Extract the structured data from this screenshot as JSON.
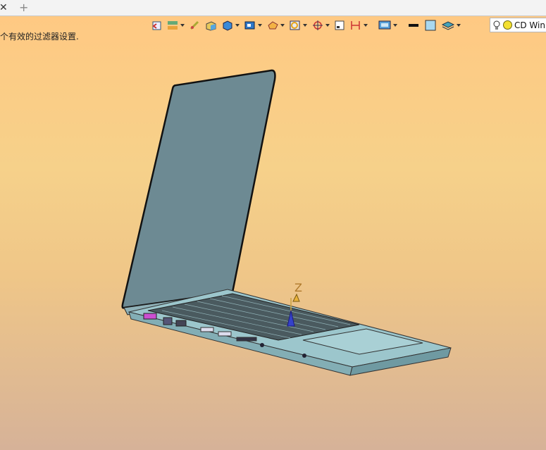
{
  "tabs": {
    "close_glyph": "✕",
    "add_glyph": "+"
  },
  "status_message": "个有效的过滤器设置.",
  "toolbar": {
    "icons": [
      "undo-view-icon",
      "layer-icon",
      "measure-icon",
      "box-shading-icon",
      "cube-view-icon",
      "render-mode-icon",
      "section-icon",
      "zoom-fit-icon",
      "snap-icon",
      "small-box-icon",
      "bracket-icon",
      "display-settings-icon",
      "black-line-icon",
      "background-color-icon",
      "layers-stack-icon"
    ],
    "filter": {
      "label": "CD Win"
    }
  },
  "viewport": {
    "axis_label": "Z",
    "colors": {
      "top": "#ffc983",
      "bottom": "#d6b298",
      "model": "#6d8a93"
    }
  }
}
